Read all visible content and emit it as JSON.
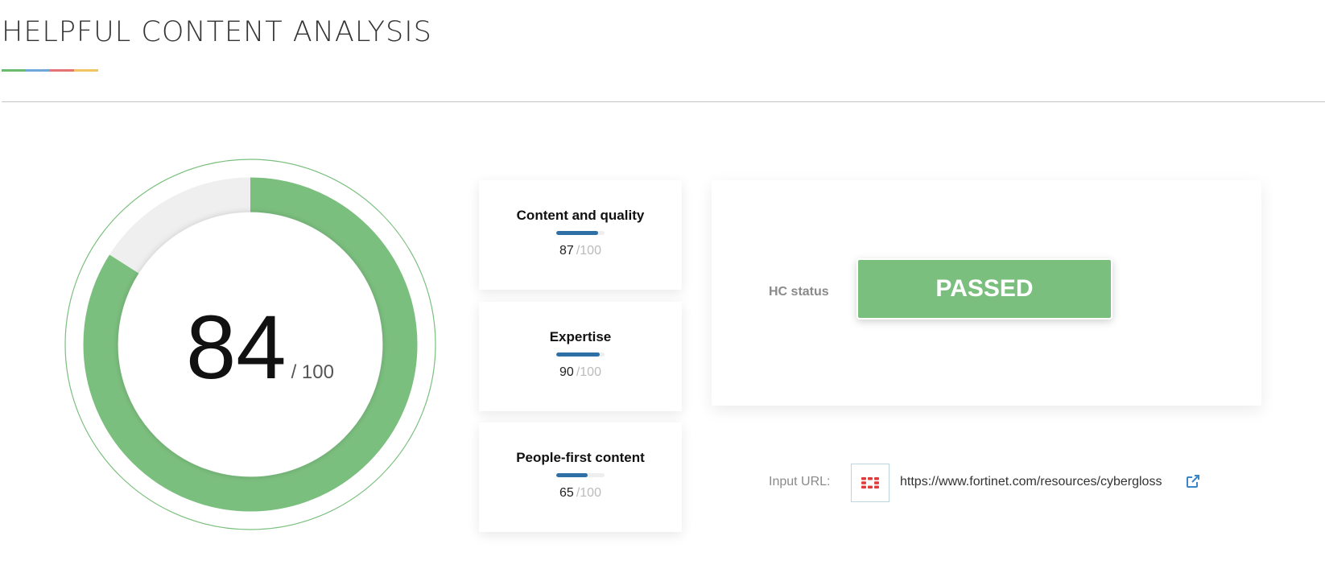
{
  "header": {
    "title": "HELPFUL CONTENT ANALYSIS",
    "underline_colors": [
      "#6cba6e",
      "#6fa8d8",
      "#e57373",
      "#f2c464"
    ]
  },
  "score": {
    "value": "84",
    "max_label": "/ 100",
    "fraction": 0.84,
    "color": "#7bbf7e"
  },
  "metrics": [
    {
      "label": "Content and quality",
      "value": "87",
      "max_label": "/100",
      "fraction": 0.87
    },
    {
      "label": "Expertise",
      "value": "90",
      "max_label": "/100",
      "fraction": 0.9
    },
    {
      "label": "People-first content",
      "value": "65",
      "max_label": "/100",
      "fraction": 0.65
    }
  ],
  "status": {
    "label": "HC status",
    "value": "PASSED",
    "color": "#7bbf7e"
  },
  "input_url": {
    "label": "Input URL:",
    "url": "https://www.fortinet.com/resources/cybergloss",
    "favicon": "fortinet-logo-icon",
    "link_icon": "external-link-icon",
    "link_color": "#3a86c8"
  }
}
